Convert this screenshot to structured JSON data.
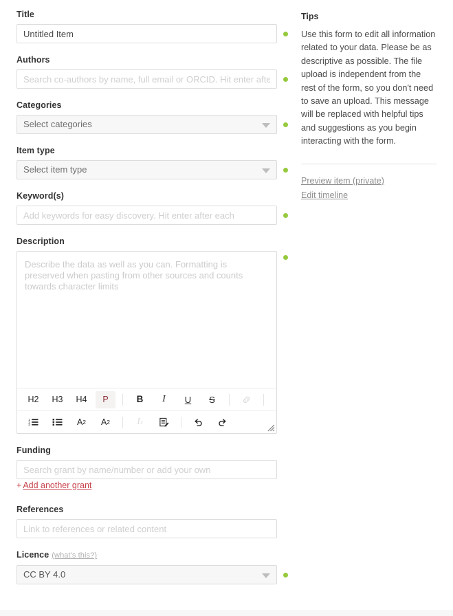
{
  "form": {
    "title": {
      "label": "Title",
      "value": "Untitled Item",
      "placeholder": "Title"
    },
    "authors": {
      "label": "Authors",
      "value": "",
      "placeholder": "Search co-authors by name, full email or ORCID. Hit enter after each."
    },
    "categories": {
      "label": "Categories",
      "value": "Select categories"
    },
    "item_type": {
      "label": "Item type",
      "value": "Select item type"
    },
    "keywords": {
      "label": "Keyword(s)",
      "value": "",
      "placeholder": "Add keywords for easy discovery. Hit enter after each"
    },
    "description": {
      "label": "Description",
      "value": "",
      "placeholder": "Describe the data as well as you can. Formatting is preserved when pasting from other sources and counts towards character limits"
    },
    "funding": {
      "label": "Funding",
      "value": "",
      "placeholder": "Search grant by name/number or add your own",
      "add_another_plus": "+",
      "add_another_label": "Add another grant"
    },
    "references": {
      "label": "References",
      "value": "",
      "placeholder": "Link to references or related content"
    },
    "licence": {
      "label": "Licence",
      "hint": "(what's this?)",
      "value": "CC BY 4.0"
    }
  },
  "editor_toolbar": {
    "row1": [
      {
        "name": "heading-2",
        "label": "H2",
        "style": "plain",
        "active": false,
        "disabled": false
      },
      {
        "name": "heading-3",
        "label": "H3",
        "style": "plain",
        "active": false,
        "disabled": false
      },
      {
        "name": "heading-4",
        "label": "H4",
        "style": "plain",
        "active": false,
        "disabled": false
      },
      {
        "name": "paragraph",
        "label": "P",
        "style": "plain",
        "active": true,
        "disabled": false
      },
      {
        "name": "separator",
        "label": "",
        "style": "sep",
        "active": false,
        "disabled": false
      },
      {
        "name": "bold",
        "label": "B",
        "style": "bold",
        "active": false,
        "disabled": false
      },
      {
        "name": "italic",
        "label": "I",
        "style": "italic",
        "active": false,
        "disabled": false
      },
      {
        "name": "underline",
        "label": "U",
        "style": "under",
        "active": false,
        "disabled": false
      },
      {
        "name": "strikethrough",
        "label": "S",
        "style": "strike",
        "active": false,
        "disabled": false
      },
      {
        "name": "separator",
        "label": "",
        "style": "sep",
        "active": false,
        "disabled": false
      },
      {
        "name": "link",
        "label": "",
        "style": "icon-link",
        "active": false,
        "disabled": true
      },
      {
        "name": "separator",
        "label": "",
        "style": "sep",
        "active": false,
        "disabled": false
      }
    ],
    "row2": [
      {
        "name": "ordered-list",
        "label": "",
        "style": "icon-ol",
        "active": false,
        "disabled": false
      },
      {
        "name": "bullet-list",
        "label": "",
        "style": "icon-ul",
        "active": false,
        "disabled": false
      },
      {
        "name": "subscript",
        "label": "A",
        "sub": "2",
        "style": "subscript",
        "active": false,
        "disabled": false
      },
      {
        "name": "superscript",
        "label": "A",
        "sup": "2",
        "style": "superscript",
        "active": false,
        "disabled": false
      },
      {
        "name": "separator",
        "label": "",
        "style": "sep",
        "active": false,
        "disabled": false
      },
      {
        "name": "clear-formatting",
        "label": "I",
        "sub": "x",
        "style": "clearfmt",
        "active": false,
        "disabled": true
      },
      {
        "name": "edit-source",
        "label": "",
        "style": "icon-source",
        "active": false,
        "disabled": false
      },
      {
        "name": "separator",
        "label": "",
        "style": "sep",
        "active": false,
        "disabled": false
      },
      {
        "name": "undo",
        "label": "",
        "style": "icon-undo",
        "active": false,
        "disabled": false
      },
      {
        "name": "redo",
        "label": "",
        "style": "icon-redo",
        "active": false,
        "disabled": false
      }
    ]
  },
  "sidebar": {
    "title": "Tips",
    "body": "Use this form to edit all information related to your data. Please be as descriptive as possible. The file upload is independent from the rest of the form, so you don't need to save an upload. This message will be replaced with helpful tips and suggestions as you begin interacting with the form.",
    "links": [
      {
        "name": "preview-item",
        "label": "Preview item (private)"
      },
      {
        "name": "edit-timeline",
        "label": "Edit timeline"
      }
    ]
  },
  "colors": {
    "status_dot": "#97c93d",
    "accent_link": "#c7414a",
    "active_toolbar_text": "#8b2f35",
    "field_border": "#dddddd",
    "select_bg": "#f7f7f7"
  }
}
